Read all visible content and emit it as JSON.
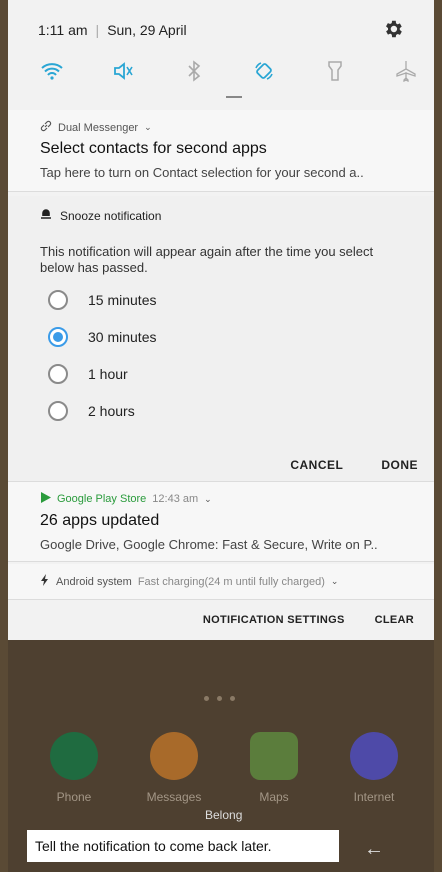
{
  "status": {
    "time": "1:11 am",
    "date": "Sun, 29 April",
    "separator": "|"
  },
  "quick_settings": [
    "wifi-icon",
    "sound-mute-icon",
    "bluetooth-icon",
    "auto-rotate-icon",
    "flashlight-icon",
    "airplane-icon"
  ],
  "dual_messenger": {
    "app": "Dual Messenger",
    "title": "Select contacts for second apps",
    "body": "Tap here to turn on Contact selection for your second a.."
  },
  "snooze": {
    "header": "Snooze notification",
    "description": "This notification will appear again after the time you select below has passed.",
    "options": [
      "15 minutes",
      "30 minutes",
      "1 hour",
      "2 hours"
    ],
    "selected": "30 minutes",
    "cancel": "CANCEL",
    "done": "DONE"
  },
  "play_store": {
    "app": "Google Play Store",
    "time": "12:43 am",
    "title": "26 apps updated",
    "body": "Google Drive, Google Chrome: Fast & Secure, Write on P.."
  },
  "android_system": {
    "app": "Android system",
    "text": "Fast charging(24 m until fully charged)"
  },
  "footer": {
    "settings": "NOTIFICATION SETTINGS",
    "clear": "CLEAR"
  },
  "dock": [
    {
      "label": "Phone",
      "color": "#1f8a4c"
    },
    {
      "label": "Messages",
      "color": "#e58a2a"
    },
    {
      "label": "Maps",
      "color": "#4a8f4a"
    },
    {
      "label": "Internet",
      "color": "#5b4fcf"
    }
  ],
  "overlay": {
    "belong": "Belong",
    "caption": "Tell the notification to come back later."
  },
  "colors": {
    "accent": "#3a9be8",
    "qs_icon": "#2aa6d4",
    "play_green": "#2a9b3c"
  }
}
